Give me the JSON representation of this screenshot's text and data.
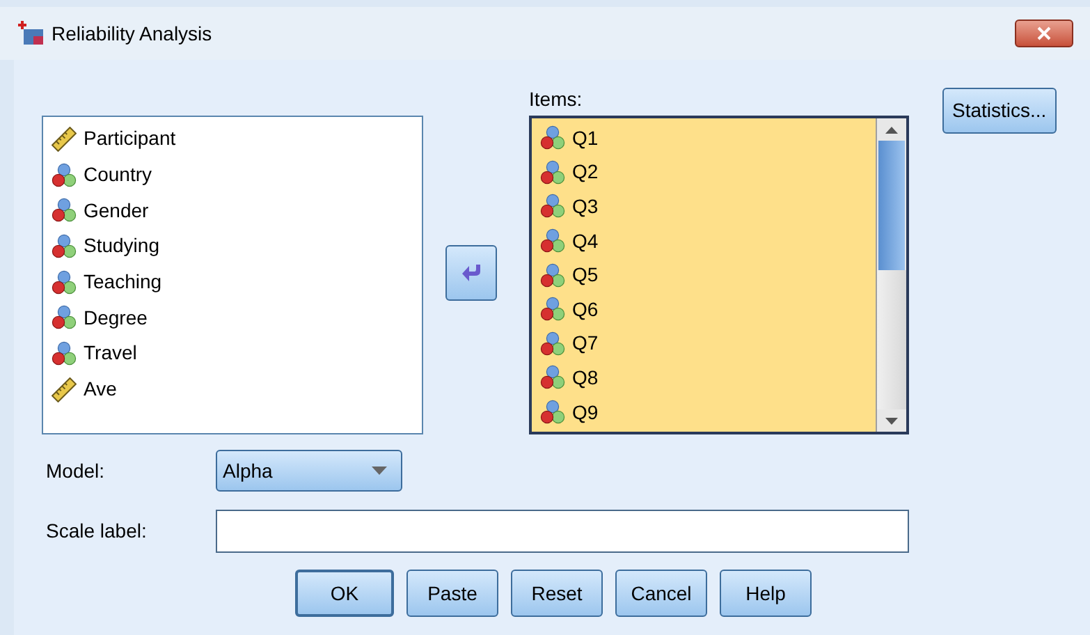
{
  "window": {
    "title": "Reliability Analysis"
  },
  "variables": [
    {
      "name": "Participant",
      "kind": "scale"
    },
    {
      "name": "Country",
      "kind": "nominal"
    },
    {
      "name": "Gender",
      "kind": "nominal"
    },
    {
      "name": "Studying",
      "kind": "nominal"
    },
    {
      "name": "Teaching",
      "kind": "nominal"
    },
    {
      "name": "Degree",
      "kind": "nominal"
    },
    {
      "name": "Travel",
      "kind": "nominal"
    },
    {
      "name": "Ave",
      "kind": "scale"
    }
  ],
  "items_label": "Items:",
  "items": [
    {
      "name": "Q1",
      "kind": "nominal"
    },
    {
      "name": "Q2",
      "kind": "nominal"
    },
    {
      "name": "Q3",
      "kind": "nominal"
    },
    {
      "name": "Q4",
      "kind": "nominal"
    },
    {
      "name": "Q5",
      "kind": "nominal"
    },
    {
      "name": "Q6",
      "kind": "nominal"
    },
    {
      "name": "Q7",
      "kind": "nominal"
    },
    {
      "name": "Q8",
      "kind": "nominal"
    },
    {
      "name": "Q9",
      "kind": "nominal"
    }
  ],
  "statistics_button": "Statistics...",
  "model": {
    "label": "Model:",
    "value": "Alpha"
  },
  "scale_label": {
    "label": "Scale label:"
  },
  "buttons": [
    {
      "label": "OK",
      "default": true
    },
    {
      "label": "Paste",
      "default": false
    },
    {
      "label": "Reset",
      "default": false
    },
    {
      "label": "Cancel",
      "default": false
    },
    {
      "label": "Help",
      "default": false
    }
  ]
}
